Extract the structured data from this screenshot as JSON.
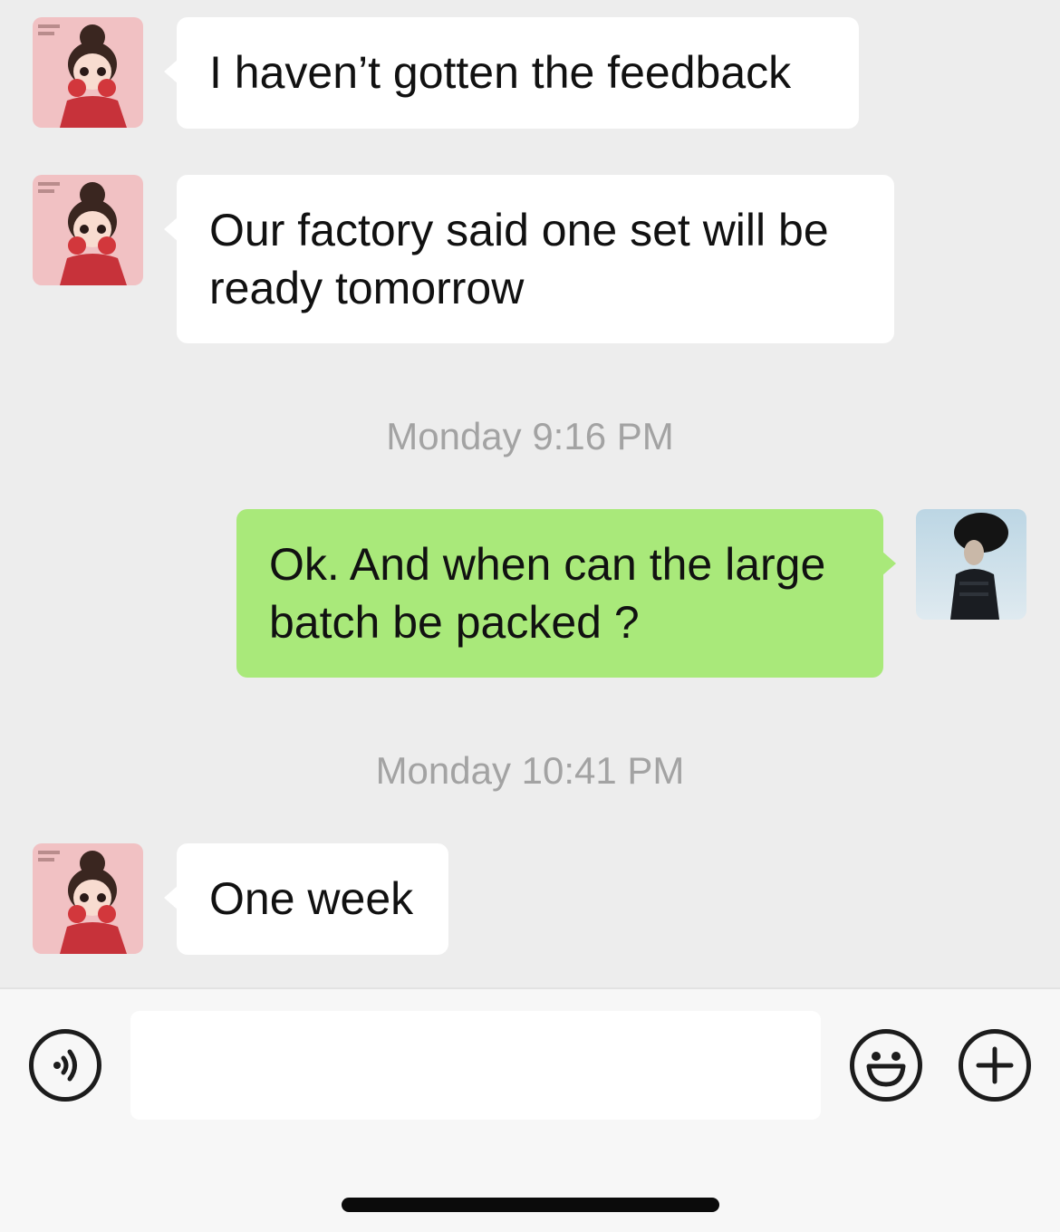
{
  "messages": [
    {
      "direction": "incoming",
      "sender": "contact",
      "text": "I haven’t gotten the feedback"
    },
    {
      "direction": "incoming",
      "sender": "contact",
      "text_lines": [
        "Our factory said one set will be",
        "ready tomorrow"
      ]
    },
    {
      "timestamp": "Monday 9:16 PM"
    },
    {
      "direction": "outgoing",
      "sender": "me",
      "text_lines": [
        "Ok. And when can the large",
        "batch be packed ?"
      ]
    },
    {
      "timestamp": "Monday 10:41 PM"
    },
    {
      "direction": "incoming",
      "sender": "contact",
      "text": "One week"
    }
  ],
  "input": {
    "value": "",
    "placeholder": "",
    "voice_icon": "voice-icon",
    "emoji_icon": "emoji-icon",
    "add_icon": "add-icon"
  },
  "colors": {
    "background": "#ededed",
    "incoming_bubble": "#ffffff",
    "outgoing_bubble": "#a9e97a",
    "timestamp_text": "#a3a3a3",
    "input_bar": "#f7f7f7"
  }
}
